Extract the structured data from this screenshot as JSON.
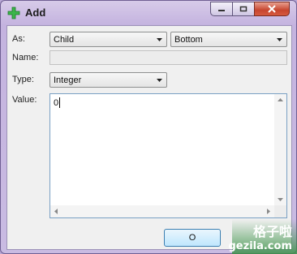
{
  "window": {
    "title": "Add"
  },
  "form": {
    "as_label": "As:",
    "as_value": "Child",
    "position_value": "Bottom",
    "name_label": "Name:",
    "name_value": "",
    "type_label": "Type:",
    "type_value": "Integer",
    "value_label": "Value:",
    "value_value": "0"
  },
  "buttons": {
    "ok_partial": "O"
  },
  "watermark": {
    "text_cn": "格子啦",
    "url": "gezila.com"
  },
  "colors": {
    "title_bg": "#c4b3df",
    "client_bg": "#f0f0f0",
    "close_btn": "#c7452e",
    "watermark": "#3a9146"
  },
  "icons": [
    "add-plus-icon",
    "minimize-icon",
    "maximize-icon",
    "close-icon",
    "dropdown-arrow-icon",
    "scroll-up-icon",
    "scroll-down-icon",
    "scroll-left-icon",
    "scroll-right-icon"
  ]
}
